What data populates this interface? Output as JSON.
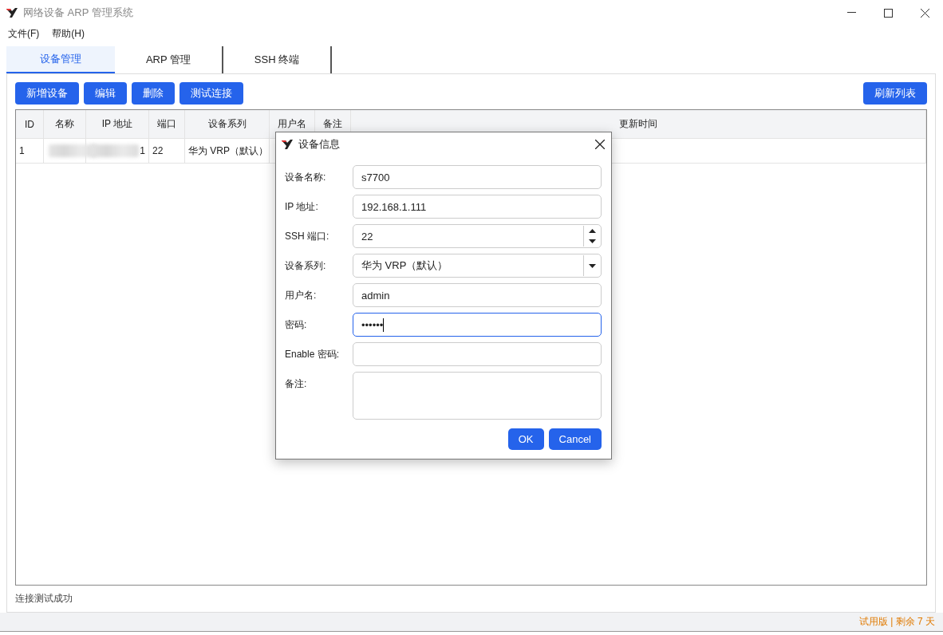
{
  "window": {
    "title": "网络设备 ARP 管理系统"
  },
  "menu": [
    "文件(F)",
    "帮助(H)"
  ],
  "tabs": [
    {
      "label": "设备管理",
      "selected": true
    },
    {
      "label": "ARP 管理",
      "selected": false
    },
    {
      "label": "SSH 终端",
      "selected": false
    }
  ],
  "toolbar": {
    "left": [
      "新增设备",
      "编辑",
      "删除",
      "测试连接"
    ],
    "right": "刷新列表"
  },
  "table": {
    "columns": [
      "ID",
      "名称",
      "IP 地址",
      "端口",
      "设备系列",
      "用户名",
      "备注",
      "更新时间"
    ],
    "rows": [
      {
        "cells": [
          {
            "text": "1"
          },
          {
            "kind": "redacted"
          },
          {
            "kind": "redacted",
            "text": "1"
          },
          {
            "text": "22"
          },
          {
            "text": "华为 VRP（默认）"
          },
          {},
          {},
          {}
        ]
      }
    ]
  },
  "status": "连接测试成功",
  "trial": "试用版 | 剩余 7 天",
  "dialog": {
    "title": "设备信息",
    "fields": [
      {
        "label": "设备名称:",
        "kind": "text",
        "value": "s7700",
        "focused": false
      },
      {
        "label": "IP 地址:",
        "kind": "text",
        "value": "192.168.1.111",
        "focused": false
      },
      {
        "label": "SSH 端口:",
        "kind": "spin",
        "value": "22",
        "focused": false
      },
      {
        "label": "设备系列:",
        "kind": "select",
        "value": "华为 VRP（默认）",
        "focused": false
      },
      {
        "label": "用户名:",
        "kind": "text",
        "value": "admin",
        "focused": false
      },
      {
        "label": "密码:",
        "kind": "text",
        "value": "••••••",
        "focused": true
      },
      {
        "label": "Enable 密码:",
        "kind": "text",
        "focused": false
      },
      {
        "label": "备注:",
        "kind": "area",
        "focused": false
      }
    ],
    "buttons": [
      "OK",
      "Cancel"
    ]
  }
}
